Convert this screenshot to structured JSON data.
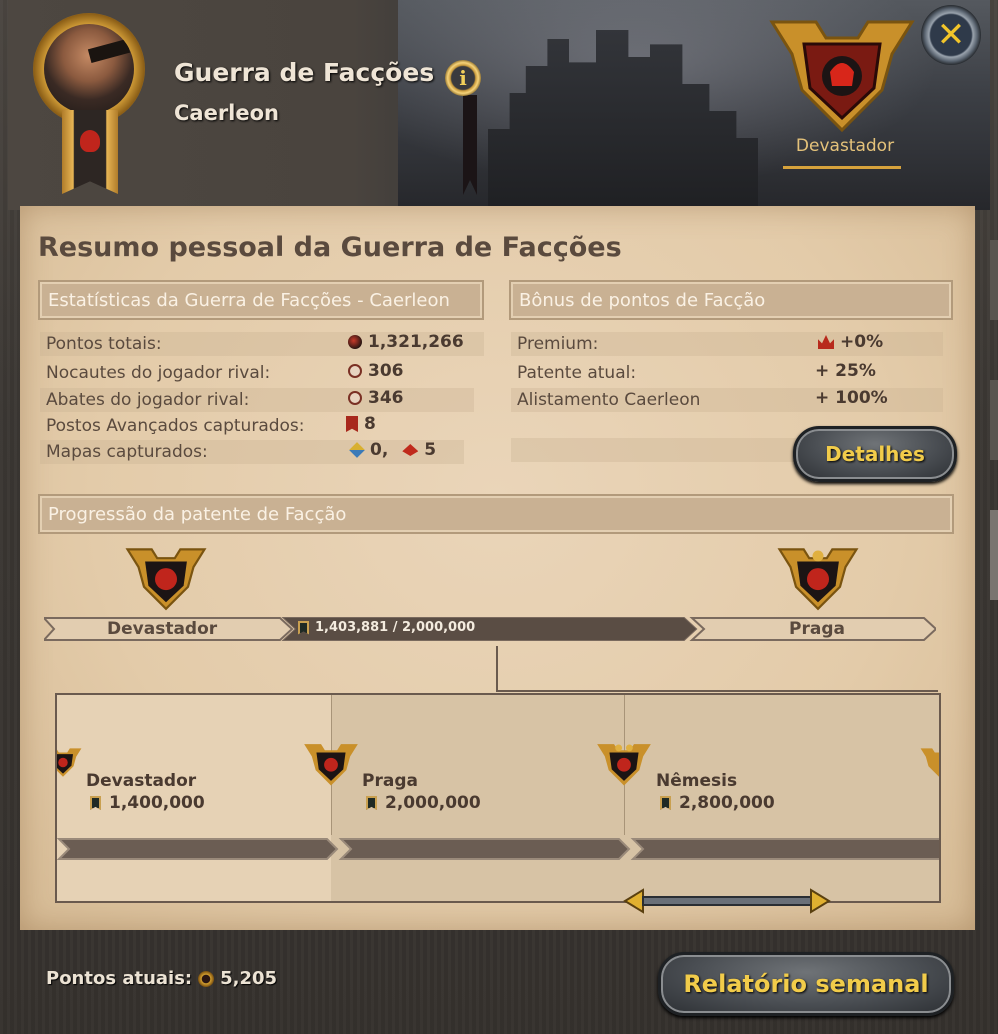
{
  "header": {
    "title": "Guerra de Facções",
    "subtitle": "Caerleon",
    "info_icon": "i",
    "close_icon": "✕",
    "current_rank": "Devastador"
  },
  "summary": {
    "title": "Resumo pessoal da Guerra de Facções",
    "stats_header": "Estatísticas da Guerra de Facções - Caerleon",
    "bonus_header": "Bônus de pontos de Facção",
    "stats": [
      {
        "label": "Pontos totais:",
        "value": "1,321,266",
        "icon": "faction-points-icon"
      },
      {
        "label": "Nocautes do jogador rival:",
        "value": "306",
        "icon": "crossed-swords-icon"
      },
      {
        "label": "Abates do jogador rival:",
        "value": "346",
        "icon": "crossed-swords-icon"
      },
      {
        "label": "Postos Avançados capturados:",
        "value": "8",
        "icon": "outpost-flag-icon"
      }
    ],
    "maps_label": "Mapas capturados:",
    "maps_values": [
      "0,",
      "5"
    ],
    "bonuses": [
      {
        "label": "Premium:",
        "value": "+0%",
        "icon": "crown-icon"
      },
      {
        "label": "Patente atual:",
        "value": "+ 25%"
      },
      {
        "label": "Alistamento Caerleon",
        "value": "+ 100%"
      }
    ],
    "details_button": "Detalhes"
  },
  "progression": {
    "header": "Progressão da patente de Facção",
    "current": "Devastador",
    "next": "Praga",
    "progress_text": "1,403,881 / 2,000,000",
    "progress_current": 1403881,
    "progress_target": 2000000,
    "tiers": [
      {
        "name": "Devastador",
        "points": "1,400,000"
      },
      {
        "name": "Praga",
        "points": "2,000,000"
      },
      {
        "name": "Nêmesis",
        "points": "2,800,000"
      }
    ]
  },
  "footer": {
    "current_points_label": "Pontos atuais:",
    "current_points_value": "5,205",
    "weekly_report_button": "Relatório semanal"
  },
  "colors": {
    "parchment": "#e3cba9",
    "accent_gold": "#f2cc4a",
    "faction_red": "#c0251c"
  }
}
